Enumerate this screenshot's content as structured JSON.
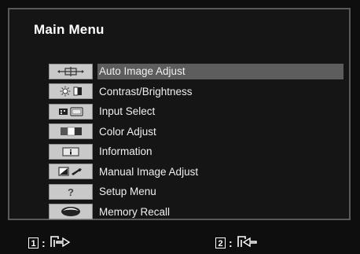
{
  "menu": {
    "title": "Main Menu",
    "items": [
      {
        "label": "Auto Image Adjust",
        "icon": "auto-adjust-icon",
        "selected": true
      },
      {
        "label": "Contrast/Brightness",
        "icon": "brightness-icon",
        "selected": false
      },
      {
        "label": "Input Select",
        "icon": "input-select-icon",
        "selected": false
      },
      {
        "label": "Color Adjust",
        "icon": "color-adjust-icon",
        "selected": false
      },
      {
        "label": "Information",
        "icon": "information-icon",
        "selected": false
      },
      {
        "label": "Manual Image Adjust",
        "icon": "manual-adjust-icon",
        "selected": false
      },
      {
        "label": "Setup Menu",
        "icon": "setup-icon",
        "selected": false
      },
      {
        "label": "Memory Recall",
        "icon": "memory-recall-icon",
        "selected": false
      }
    ]
  },
  "footer": {
    "key1": {
      "number": "1",
      "separator": ":",
      "icon": "exit-icon"
    },
    "key2": {
      "number": "2",
      "separator": ":",
      "icon": "enter-icon"
    }
  },
  "colors": {
    "selected_bg": "#5d5d5d",
    "icon_bg": "#c9c9c9",
    "frame": "#5a5a5a"
  }
}
